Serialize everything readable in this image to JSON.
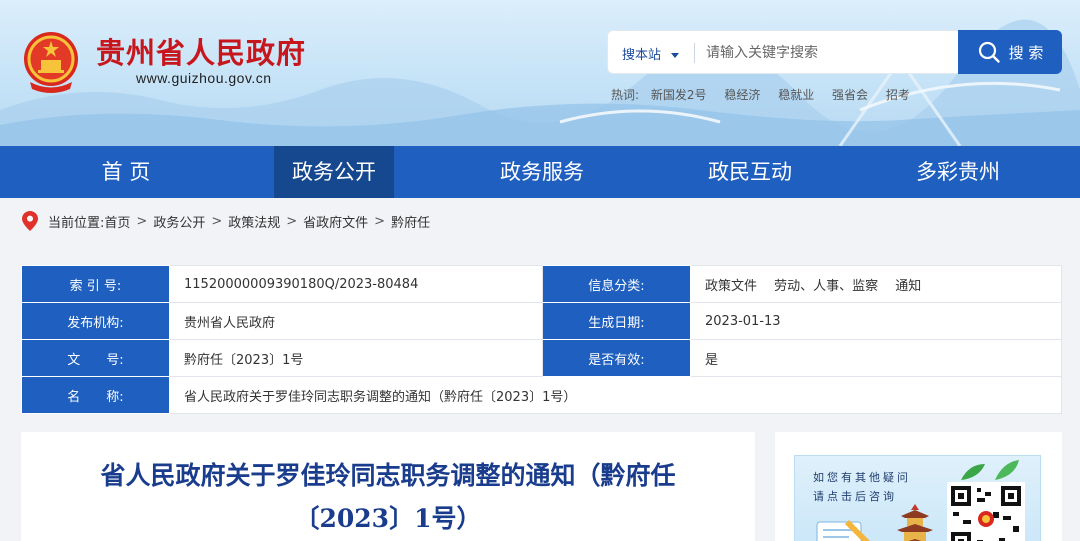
{
  "site": {
    "name": "贵州省人民政府",
    "url": "www.guizhou.gov.cn"
  },
  "search": {
    "scope_label": "搜本站",
    "placeholder": "请输入关键字搜索",
    "button_label": "搜 索",
    "hot_label": "热词:",
    "hot_words": [
      "新国发2号",
      "稳经济",
      "稳就业",
      "强省会",
      "招考"
    ]
  },
  "nav": {
    "items": [
      {
        "label": "首 页"
      },
      {
        "label": "政务公开"
      },
      {
        "label": "政务服务"
      },
      {
        "label": "政民互动"
      },
      {
        "label": "多彩贵州"
      }
    ],
    "active_index": 1
  },
  "breadcrumb": {
    "prefix": "当前位置:",
    "items": [
      "首页",
      "政务公开",
      "政策法规",
      "省政府文件",
      "黔府任"
    ],
    "separator": ">"
  },
  "info": {
    "index_no": {
      "label": "索 引 号:",
      "value": "11520000009390180Q/2023-80484"
    },
    "category": {
      "label": "信息分类:",
      "value": "政策文件　 劳动、人事、监察　 通知"
    },
    "publisher": {
      "label": "发布机构:",
      "value": "贵州省人民政府"
    },
    "date": {
      "label": "生成日期:",
      "value": "2023-01-13"
    },
    "doc_no": {
      "label": "文　　号:",
      "value": "黔府任〔2023〕1号"
    },
    "valid": {
      "label": "是否有效:",
      "value": "是"
    },
    "name": {
      "label": "名　　称:",
      "value": "省人民政府关于罗佳玲同志职务调整的通知（黔府任〔2023〕1号）"
    }
  },
  "article": {
    "title": "省人民政府关于罗佳玲同志职务调整的通知（黔府任〔2023〕1号）"
  },
  "side": {
    "line1": "如您有其他疑问",
    "line2": "请点击后咨询"
  },
  "colors": {
    "primary": "#1e5fbf",
    "nav_active": "#15488f",
    "brand_red": "#c8161d",
    "title_blue": "#1a3c8c"
  }
}
